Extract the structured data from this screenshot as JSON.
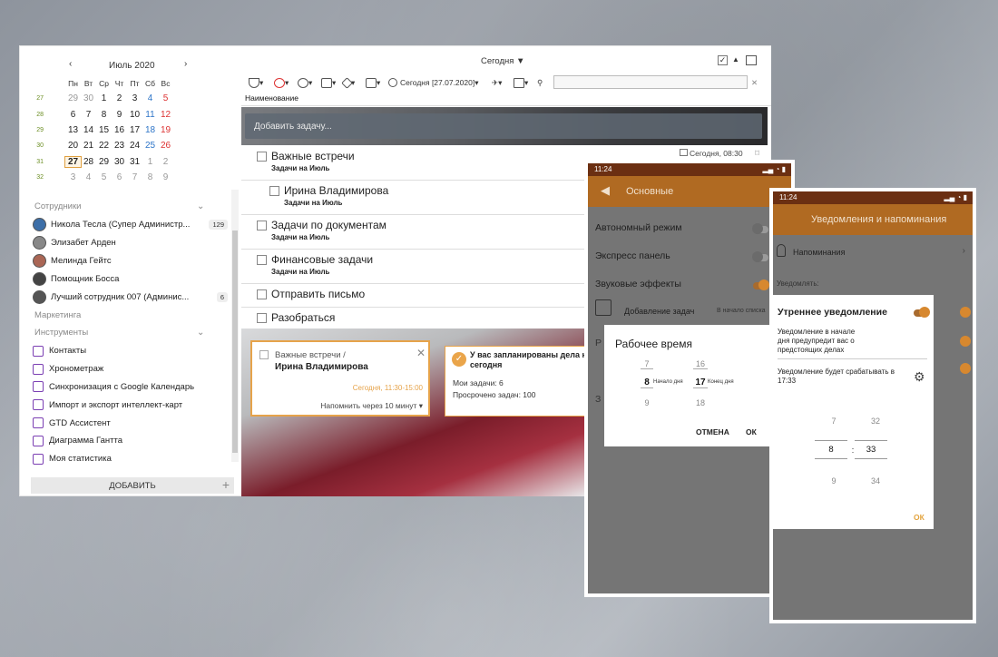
{
  "calendar": {
    "prev": "‹",
    "title": "Июль 2020",
    "next": "›",
    "weekdays": [
      "Пн",
      "Вт",
      "Ср",
      "Чт",
      "Пт",
      "Сб",
      "Вс"
    ],
    "weeks": [
      {
        "wk": "27",
        "days": [
          [
            "29",
            "o"
          ],
          [
            "30",
            "o"
          ],
          [
            "1",
            ""
          ],
          [
            "2",
            ""
          ],
          [
            "3",
            ""
          ],
          [
            "4",
            "sa"
          ],
          [
            "5",
            "su"
          ]
        ]
      },
      {
        "wk": "28",
        "days": [
          [
            "6",
            ""
          ],
          [
            "7",
            ""
          ],
          [
            "8",
            ""
          ],
          [
            "9",
            ""
          ],
          [
            "10",
            ""
          ],
          [
            "11",
            "sa"
          ],
          [
            "12",
            "su"
          ]
        ]
      },
      {
        "wk": "29",
        "days": [
          [
            "13",
            ""
          ],
          [
            "14",
            ""
          ],
          [
            "15",
            ""
          ],
          [
            "16",
            ""
          ],
          [
            "17",
            ""
          ],
          [
            "18",
            "sa"
          ],
          [
            "19",
            "su"
          ]
        ]
      },
      {
        "wk": "30",
        "days": [
          [
            "20",
            ""
          ],
          [
            "21",
            ""
          ],
          [
            "22",
            ""
          ],
          [
            "23",
            ""
          ],
          [
            "24",
            ""
          ],
          [
            "25",
            "sa"
          ],
          [
            "26",
            "su"
          ]
        ]
      },
      {
        "wk": "31",
        "days": [
          [
            "27",
            "today"
          ],
          [
            "28",
            ""
          ],
          [
            "29",
            ""
          ],
          [
            "30",
            ""
          ],
          [
            "31",
            ""
          ],
          [
            "1",
            "o"
          ],
          [
            "2",
            "o"
          ]
        ]
      },
      {
        "wk": "32",
        "days": [
          [
            "3",
            "o"
          ],
          [
            "4",
            "o"
          ],
          [
            "5",
            "o"
          ],
          [
            "6",
            "o"
          ],
          [
            "7",
            "o"
          ],
          [
            "8",
            "o"
          ],
          [
            "9",
            "o"
          ]
        ]
      }
    ]
  },
  "sidebar": {
    "employees_label": "Сотрудники",
    "employees": [
      {
        "name": "Никола Тесла (Супер Администр...",
        "count": "129"
      },
      {
        "name": "Элизабет Арден",
        "count": ""
      },
      {
        "name": "Мелинда Гейтс",
        "count": ""
      },
      {
        "name": "Помощник Босса",
        "count": ""
      },
      {
        "name": "Лучший сотрудник 007 (Админис...",
        "count": "6"
      }
    ],
    "marketing_label": "Маркетинга",
    "tools_label": "Инструменты",
    "tools": [
      "Контакты",
      "Хронометраж",
      "Синхронизация с Google Календарь",
      "Импорт и экспорт интеллект-карт",
      "GTD Ассистент",
      "Диаграмма Гантта",
      "Моя статистика"
    ],
    "add_button": "ДОБАВИТЬ"
  },
  "main": {
    "view_title": "Сегодня",
    "date_filter": "Сегодня [27.07.2020]",
    "column_name": "Наименование",
    "add_task_placeholder": "Добавить задачу...",
    "group_date": "Сегодня, 08:30",
    "tasks": [
      {
        "title": "Важные встречи",
        "sub": "Задачи на Июль"
      },
      {
        "title": "Ирина Владимирова",
        "sub": "Задачи на Июль"
      },
      {
        "title": "Задачи по документам",
        "sub": "Задачи на Июль"
      },
      {
        "title": "Финансовые задачи",
        "sub": "Задачи на Июль"
      },
      {
        "title": "Отправить письмо",
        "sub": ""
      },
      {
        "title": "Разобраться",
        "sub": ""
      }
    ]
  },
  "notification": {
    "line1": "Важные встречи /",
    "line2": "Ирина Владимирова",
    "time": "Сегодня, 11:30-15:00",
    "remind": "Напомнить через 10 минут"
  },
  "summary": {
    "title1": "У вас запланированы дела на",
    "title2": "сегодня",
    "my_tasks": "Мои задачи: 6",
    "overdue": "Просрочено задач: 100"
  },
  "phone1": {
    "time": "11:24",
    "header": "Основные",
    "settings": [
      {
        "label": "Автономный режим",
        "on": false
      },
      {
        "label": "Экспресс панель",
        "on": false
      },
      {
        "label": "Звуковые эффекты",
        "on": true
      }
    ],
    "add_tasks": "Добавление задач",
    "add_tasks_value": "В начало списка",
    "dialog": {
      "title": "Рабочее время",
      "start_prev": "7",
      "start": "8",
      "start_label": "Начало дня",
      "start_next": "9",
      "end_prev": "16",
      "end": "17",
      "end_label": "Конец дня",
      "end_next": "18",
      "cancel": "ОТМЕНА",
      "ok": "ОК"
    }
  },
  "phone2": {
    "time": "11:24",
    "header": "Уведомления и напоминания",
    "row": "Напоминания",
    "section": "Уведомлять:",
    "dialog": {
      "title": "Утреннее уведомление",
      "desc": "Уведомление в начале дня предупредит вас о предстоящих делах",
      "when": "Уведомление будет срабатывать в 17:33",
      "h_prev": "7",
      "h": "8",
      "sep": ":",
      "m_prev": "32",
      "m": "33",
      "h_next": "9",
      "m_next": "34",
      "ok": "ОК"
    }
  }
}
